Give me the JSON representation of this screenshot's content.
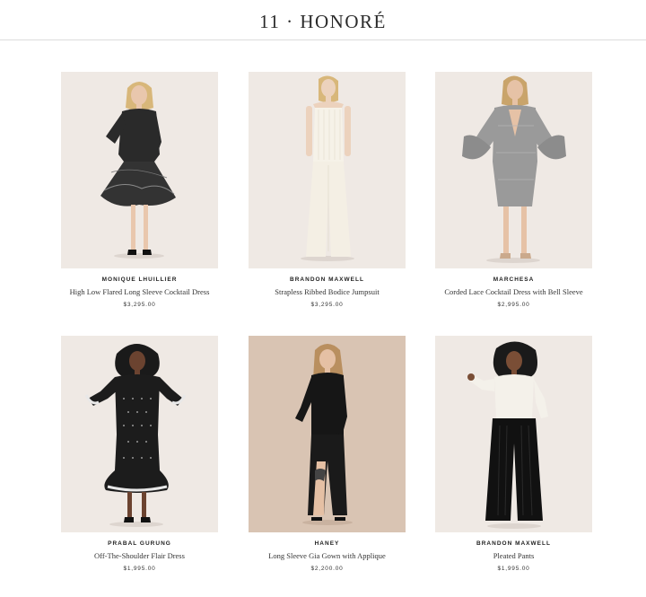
{
  "header": {
    "title": "11 · HONORÉ"
  },
  "products": [
    {
      "brand": "MONIQUE LHUILLIER",
      "name": "High Low Flared Long Sleeve Cocktail Dress",
      "price": "$3,295.00",
      "image": "black-lace-flared-dress-photo"
    },
    {
      "brand": "BRANDON MAXWELL",
      "name": "Strapless Ribbed Bodice Jumpsuit",
      "price": "$3,295.00",
      "image": "white-strapless-jumpsuit-photo"
    },
    {
      "brand": "MARCHESA",
      "name": "Corded Lace Cocktail Dress with Bell Sleeve",
      "price": "$2,995.00",
      "image": "grey-lace-bell-sleeve-dress-photo"
    },
    {
      "brand": "PRABAL GURUNG",
      "name": "Off-The-Shoulder Flair Dress",
      "price": "$1,995.00",
      "image": "black-embellished-flair-dress-photo"
    },
    {
      "brand": "HANEY",
      "name": "Long Sleeve Gia Gown with Applique",
      "price": "$2,200.00",
      "image": "black-long-sleeve-gown-photo"
    },
    {
      "brand": "BRANDON MAXWELL",
      "name": "Pleated Pants",
      "price": "$1,995.00",
      "image": "white-top-black-pleated-pants-photo"
    }
  ],
  "colors": {
    "photo_bg": "#efe9e4",
    "photo_bg_tan": "#d9c4b3",
    "text": "#222222",
    "divider": "#dcdcdc"
  }
}
